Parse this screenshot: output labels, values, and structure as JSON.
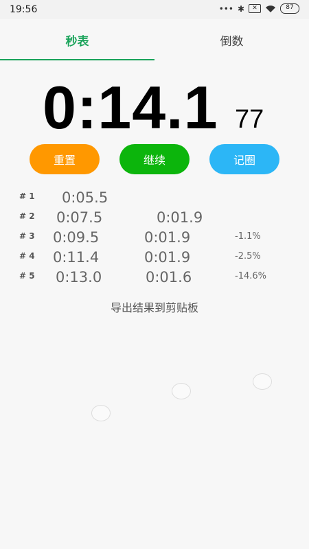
{
  "status": {
    "time": "19:56",
    "battery": "87"
  },
  "tabs": [
    {
      "label": "秒表"
    },
    {
      "label": "倒数"
    }
  ],
  "timer": {
    "main": "0:14.1",
    "ms": "77"
  },
  "buttons": {
    "reset": "重置",
    "continue": "继续",
    "lap": "记圈"
  },
  "laps": [
    {
      "index": "# 1",
      "total": "0:05.5",
      "split": "",
      "diff": ""
    },
    {
      "index": "# 2",
      "total": "0:07.5",
      "split": "0:01.9",
      "diff": ""
    },
    {
      "index": "# 3",
      "total": "0:09.5",
      "split": "0:01.9",
      "diff": "-1.1%"
    },
    {
      "index": "# 4",
      "total": "0:11.4",
      "split": "0:01.9",
      "diff": "-2.5%"
    },
    {
      "index": "# 5",
      "total": "0:13.0",
      "split": "0:01.6",
      "diff": "-14.6%"
    }
  ],
  "export_label": "导出结果到剪贴板"
}
